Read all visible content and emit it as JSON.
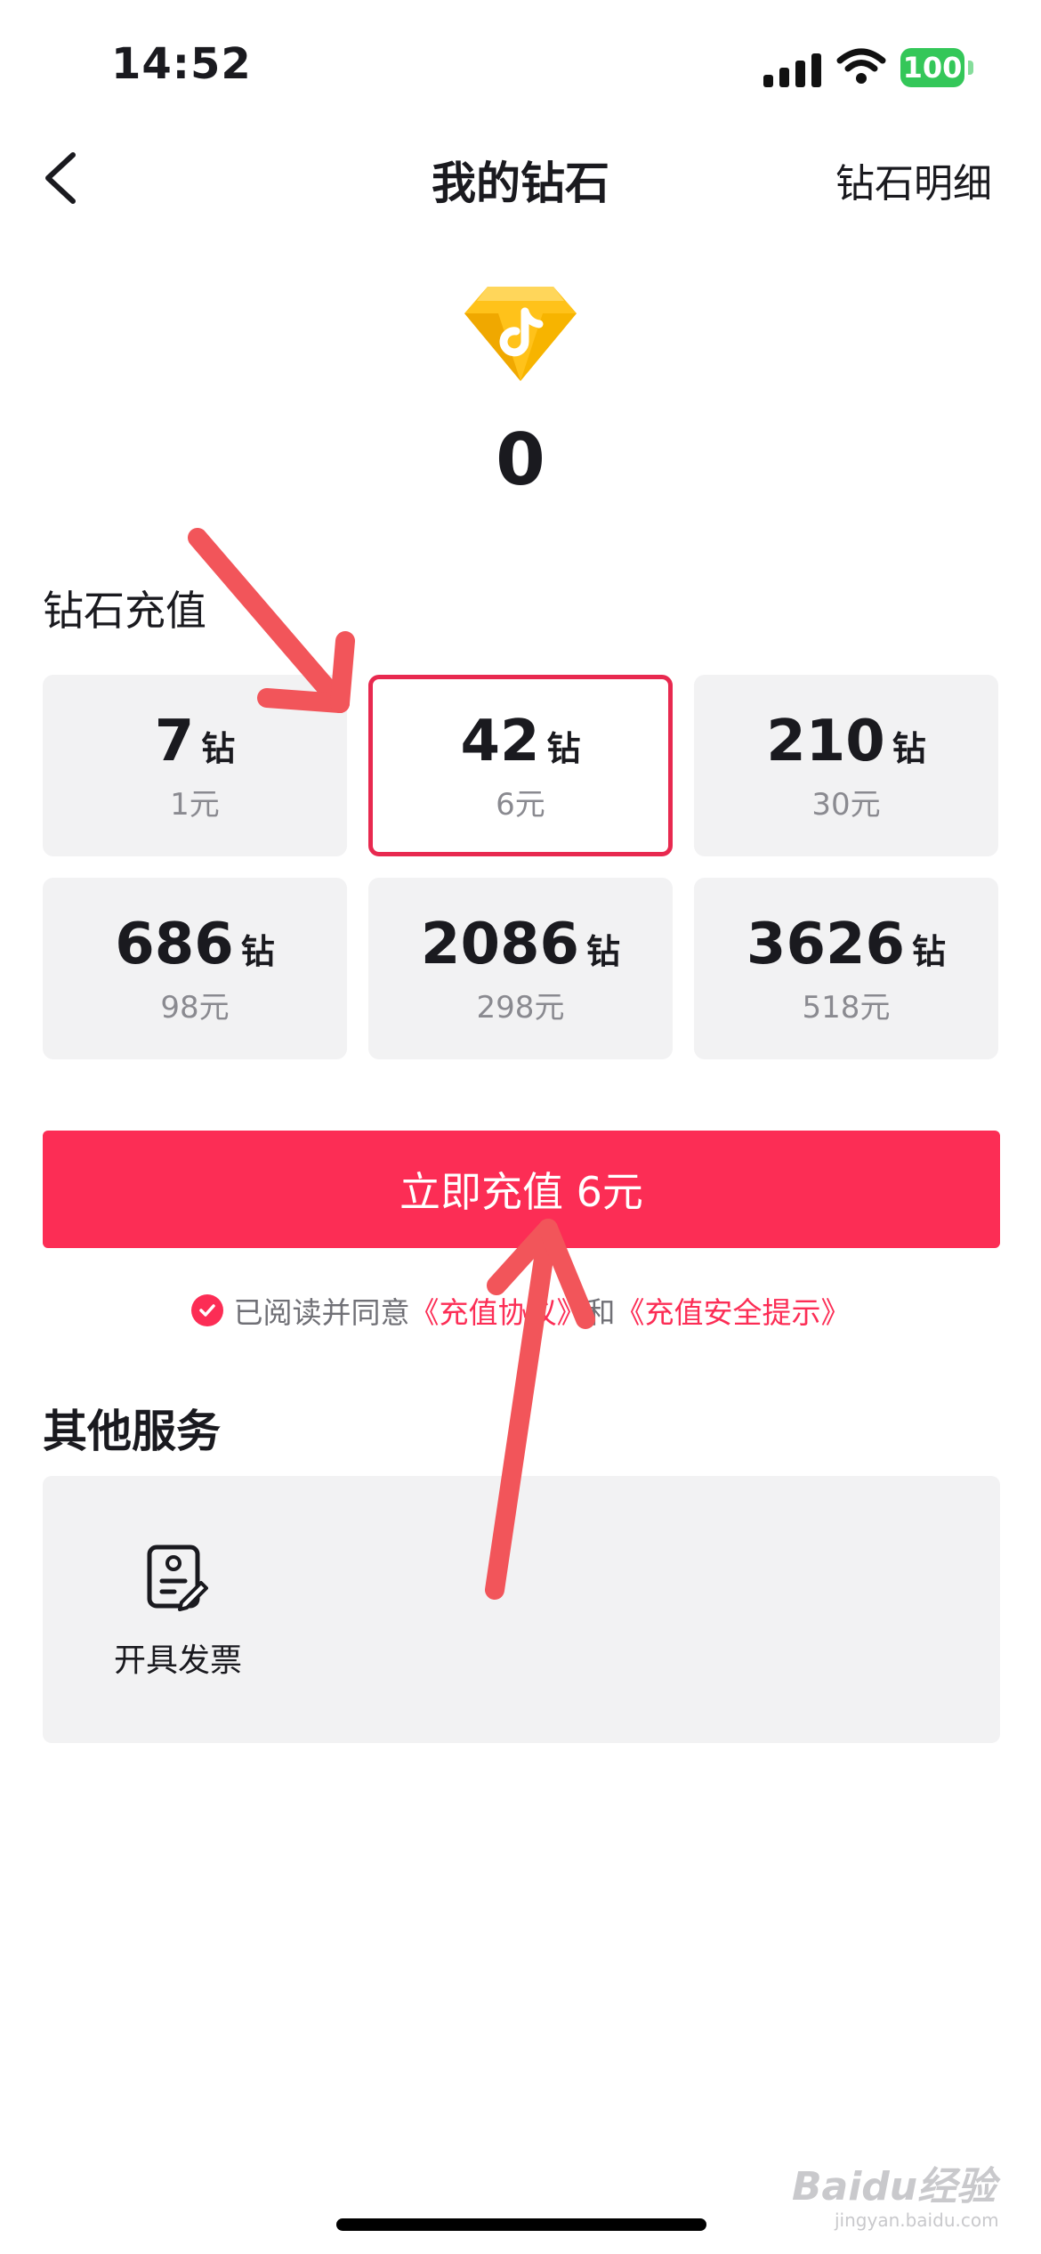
{
  "status_bar": {
    "time": "14:52",
    "battery": "100"
  },
  "nav": {
    "title": "我的钻石",
    "detail_link": "钻石明细"
  },
  "balance": {
    "value": "0"
  },
  "recharge": {
    "section_title": "钻石充值",
    "unit": "钻",
    "options": [
      {
        "amount": "7",
        "price": "1元",
        "selected": false
      },
      {
        "amount": "42",
        "price": "6元",
        "selected": true
      },
      {
        "amount": "210",
        "price": "30元",
        "selected": false
      },
      {
        "amount": "686",
        "price": "98元",
        "selected": false
      },
      {
        "amount": "2086",
        "price": "298元",
        "selected": false
      },
      {
        "amount": "3626",
        "price": "518元",
        "selected": false
      }
    ],
    "button_label": "立即充值 6元"
  },
  "agreement": {
    "prefix": "已阅读并同意",
    "link1": "《充值协议》",
    "middle": "和",
    "link2": "《充值安全提示》"
  },
  "other_services": {
    "section_title": "其他服务",
    "items": [
      {
        "label": "开具发票",
        "icon": "invoice-icon"
      }
    ]
  },
  "watermark": {
    "brand": "Baidu经验",
    "url": "jingyan.baidu.com"
  },
  "colors": {
    "accent": "#fc2d55",
    "card_bg": "#f2f2f3",
    "annotation_arrow": "#f2555a"
  }
}
